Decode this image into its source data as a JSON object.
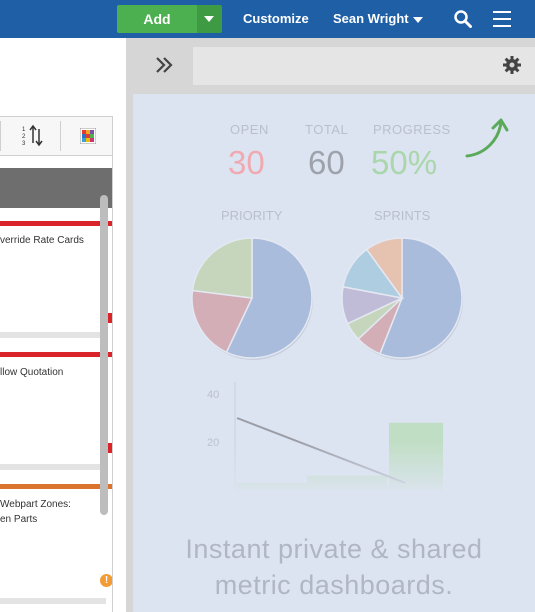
{
  "topbar": {
    "add_label": "Add",
    "customize_label": "Customize",
    "user_name": "Sean Wright"
  },
  "left_panel": {
    "cards": [
      {
        "text": "verride Rate Cards"
      },
      {
        "text": "llow Quotation"
      },
      {
        "text_line1": "Webpart Zones:",
        "text_line2": "en Parts"
      }
    ],
    "warning_glyph": "!"
  },
  "dashboard": {
    "stats": [
      {
        "label": "OPEN",
        "value": "30",
        "color": "#f0a9b0"
      },
      {
        "label": "TOTAL",
        "value": "60",
        "color": "#9ea2ab"
      },
      {
        "label": "PROGRESS",
        "value": "50%",
        "color": "#a9d7ab"
      }
    ],
    "priority_label": "PRIORITY",
    "sprints_label": "SPRINTS",
    "tagline_line1": "Instant private & shared",
    "tagline_line2": "metric dashboards."
  },
  "chart_data": [
    {
      "type": "pie",
      "title": "PRIORITY",
      "values": [
        57,
        20,
        23
      ],
      "colors": [
        "#aabcdc",
        "#d4aeb6",
        "#c6d6bd"
      ]
    },
    {
      "type": "pie",
      "title": "SPRINTS",
      "values": [
        56,
        7,
        5,
        10,
        12,
        10
      ],
      "colors": [
        "#aabcdc",
        "#d4aeb6",
        "#c6d6bd",
        "#c0bcd8",
        "#aecde0",
        "#e6c3b1"
      ]
    },
    {
      "type": "line",
      "y_ticks": [
        "40",
        "20"
      ],
      "ylim": [
        0,
        45
      ],
      "x": [
        0,
        1
      ],
      "y": [
        30,
        3
      ],
      "bars": [
        3,
        6,
        28
      ]
    }
  ]
}
